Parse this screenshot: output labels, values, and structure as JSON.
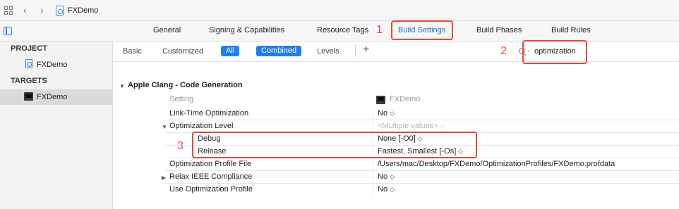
{
  "toolbar": {
    "title": "FXDemo",
    "back_icon": "chevron-left-icon",
    "forward_icon": "chevron-right-icon",
    "grid_icon": "grid-icon",
    "doc_icon": "project-file-icon"
  },
  "tabs": [
    {
      "label": "General"
    },
    {
      "label": "Signing & Capabilities"
    },
    {
      "label": "Resource Tags"
    },
    {
      "label": "Build Settings",
      "active": true
    },
    {
      "label": "Build Phases"
    },
    {
      "label": "Build Rules"
    }
  ],
  "annotations": {
    "step1": "1",
    "step2": "2",
    "step3": "3",
    "color": "#e8463b"
  },
  "sidebar": {
    "project_header": "PROJECT",
    "project_item": "FXDemo",
    "targets_header": "TARGETS",
    "target_item": "FXDemo"
  },
  "filter": {
    "basic": "Basic",
    "customized": "Customized",
    "all": "All",
    "combined": "Combined",
    "levels": "Levels",
    "add": "+",
    "search_caret": "⌄",
    "search_value": "optimization"
  },
  "section": {
    "title": "Apple Clang - Code Generation",
    "setting_header": "Setting",
    "target_header": "FXDemo"
  },
  "settings": {
    "lto": {
      "name": "Link-Time Optimization",
      "value": "No"
    },
    "opt_level": {
      "name": "Optimization Level",
      "value": "<Multiple values>"
    },
    "debug": {
      "name": "Debug",
      "value": "None [-O0]"
    },
    "release": {
      "name": "Release",
      "value": "Fastest, Smallest [-Os]"
    },
    "profile_file": {
      "name": "Optimization Profile File",
      "value": "/Users/mac/Desktop/FXDemo/OptimizationProfiles/FXDemo.profdata"
    },
    "relax_ieee": {
      "name": "Relax IEEE Compliance",
      "value": "No"
    },
    "use_profile": {
      "name": "Use Optimization Profile",
      "value": "No"
    }
  },
  "colors": {
    "accent": "#1f7df2",
    "annotation_red": "#e8463b"
  }
}
